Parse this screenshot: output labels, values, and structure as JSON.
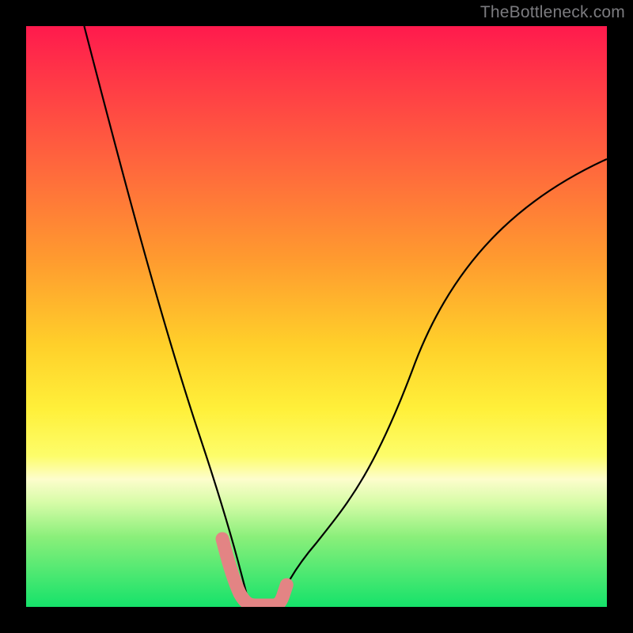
{
  "watermark": "TheBottleneck.com",
  "chart_data": {
    "type": "line",
    "title": "",
    "xlabel": "",
    "ylabel": "",
    "xlim": [
      0,
      100
    ],
    "ylim": [
      0,
      100
    ],
    "gradient_stops": [
      {
        "pos": 0,
        "color": "#ff1a4d"
      },
      {
        "pos": 10,
        "color": "#ff3b46"
      },
      {
        "pos": 25,
        "color": "#ff6a3c"
      },
      {
        "pos": 40,
        "color": "#ff9a2f"
      },
      {
        "pos": 55,
        "color": "#ffd02a"
      },
      {
        "pos": 66,
        "color": "#fff03a"
      },
      {
        "pos": 74,
        "color": "#fdfd6a"
      },
      {
        "pos": 78,
        "color": "#fdfdcc"
      },
      {
        "pos": 82,
        "color": "#d7fca8"
      },
      {
        "pos": 88,
        "color": "#8aef7a"
      },
      {
        "pos": 100,
        "color": "#15e26a"
      }
    ],
    "series": [
      {
        "name": "left-curve",
        "x": [
          10,
          15,
          20,
          25,
          30,
          33,
          35,
          37,
          38,
          38.5
        ],
        "y": [
          100,
          78,
          57,
          38,
          21,
          12,
          6.5,
          2,
          0.5,
          0
        ]
      },
      {
        "name": "right-curve",
        "x": [
          43,
          44,
          46,
          50,
          55,
          60,
          67,
          75,
          85,
          100
        ],
        "y": [
          0,
          1,
          4,
          11,
          21,
          30,
          42,
          53,
          64,
          77
        ]
      },
      {
        "name": "bottom-marker",
        "style": "thick-salmon",
        "x": [
          33.8,
          35.5,
          36.5,
          37.2,
          38.0,
          38.5,
          40.5,
          42.5,
          43.5,
          44.0,
          44.8
        ],
        "y": [
          11.5,
          6.2,
          3.5,
          1.8,
          0.7,
          0.2,
          0.1,
          0.2,
          0.7,
          1.6,
          3.6
        ]
      }
    ]
  }
}
